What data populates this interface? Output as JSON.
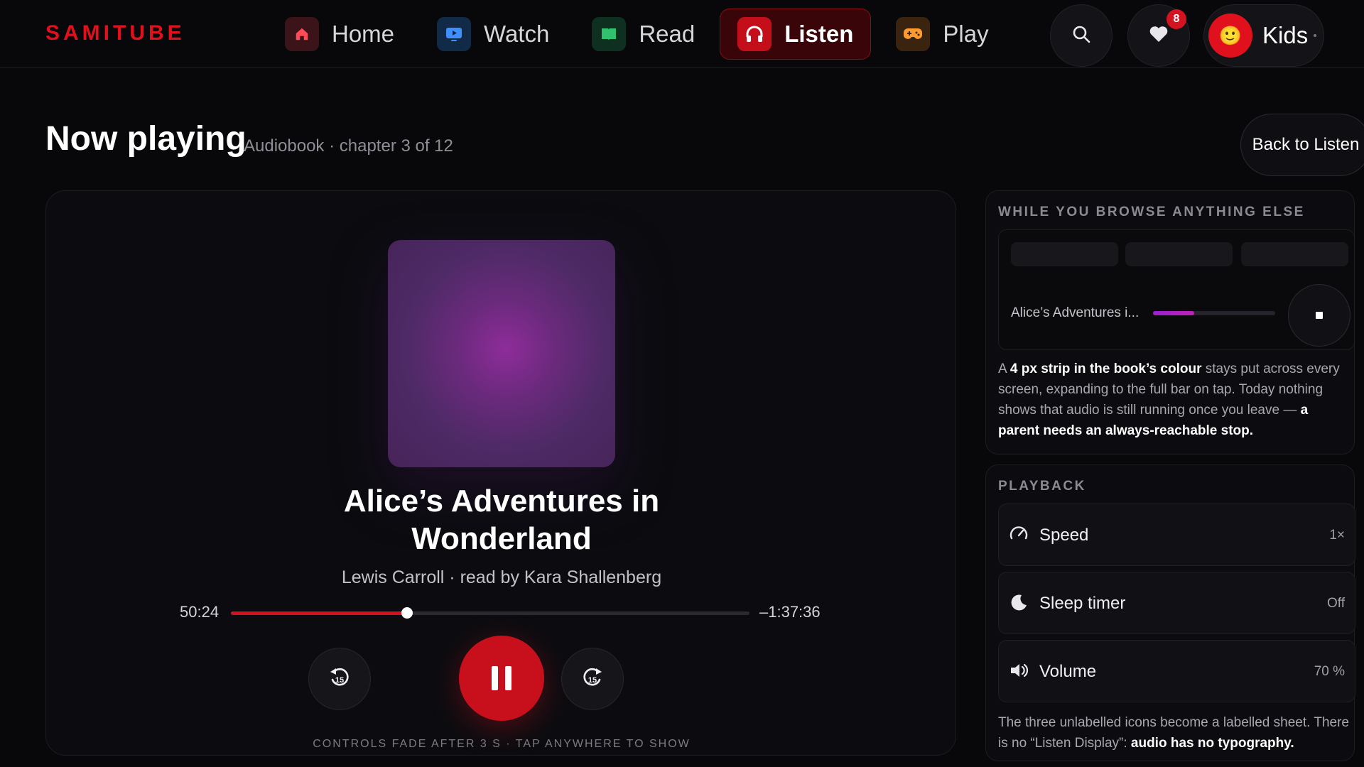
{
  "brand": "SAMITUBE",
  "nav": [
    {
      "label": "Home",
      "icon": "home-icon",
      "active": false
    },
    {
      "label": "Watch",
      "icon": "tv-icon",
      "active": false
    },
    {
      "label": "Read",
      "icon": "book-icon",
      "active": false
    },
    {
      "label": "Listen",
      "icon": "headphones-icon",
      "active": true
    },
    {
      "label": "Play",
      "icon": "gamepad-icon",
      "active": false
    }
  ],
  "header_actions": {
    "search_icon": "search-icon",
    "favorites_icon": "heart-icon",
    "favorites_badge": "8",
    "profile": {
      "label": "Kids",
      "avatar": "🙂"
    }
  },
  "page": {
    "title": "Now playing",
    "subtitle": "Audiobook · chapter 3 of 12",
    "back_label": "Back to Listen"
  },
  "player": {
    "title": "Alice’s Adventures in Wonderland",
    "author": "Lewis Carroll · read by Kara Shallenberg",
    "elapsed": "50:24",
    "remaining": "–1:37:36",
    "progress": 0.34,
    "skip_back": "15",
    "skip_forward": "15",
    "hint": "CONTROLS FADE AFTER 3 S · TAP ANYWHERE TO SHOW",
    "accent": "#c8101c"
  },
  "browse_panel": {
    "heading": "WHILE YOU BROWSE ANYTHING ELSE",
    "mini_title": "Alice’s Adventures i...",
    "mini_progress": 0.34,
    "note_parts": [
      "A ",
      "4 px strip in the book’s colour",
      " stays put across every screen, expanding to the full bar on tap. Today nothing shows that audio is still running once you leave — ",
      "a parent needs an always-reachable stop."
    ]
  },
  "playback_panel": {
    "heading": "PLAYBACK",
    "rows": [
      {
        "label": "Speed",
        "value": "1×",
        "icon": "gauge-icon"
      },
      {
        "label": "Sleep timer",
        "value": "Off",
        "icon": "moon-icon"
      },
      {
        "label": "Volume",
        "value": "70 %",
        "icon": "speaker-icon"
      }
    ],
    "note_parts": [
      "The three unlabelled icons become a labelled sheet. There is no “Listen Display”: ",
      "audio has no typography."
    ]
  }
}
